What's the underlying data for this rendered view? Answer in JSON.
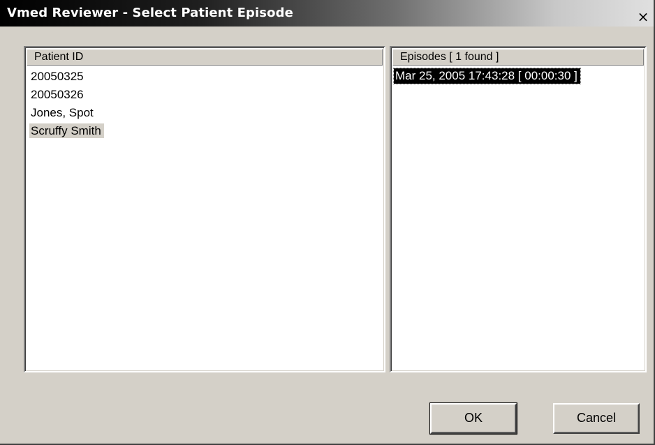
{
  "window": {
    "title": "Vmed Reviewer - Select Patient Episode",
    "close_glyph": "×"
  },
  "patients": {
    "header": "Patient ID",
    "items": [
      "20050325",
      "20050326",
      "Jones, Spot",
      "Scruffy Smith"
    ],
    "selected_index": 3
  },
  "episodes": {
    "header": "Episodes [ 1 found ]",
    "items": [
      "Mar 25, 2005  17:43:28  [ 00:00:30 ]"
    ],
    "selected_index": 0
  },
  "buttons": {
    "ok": "OK",
    "cancel": "Cancel"
  }
}
